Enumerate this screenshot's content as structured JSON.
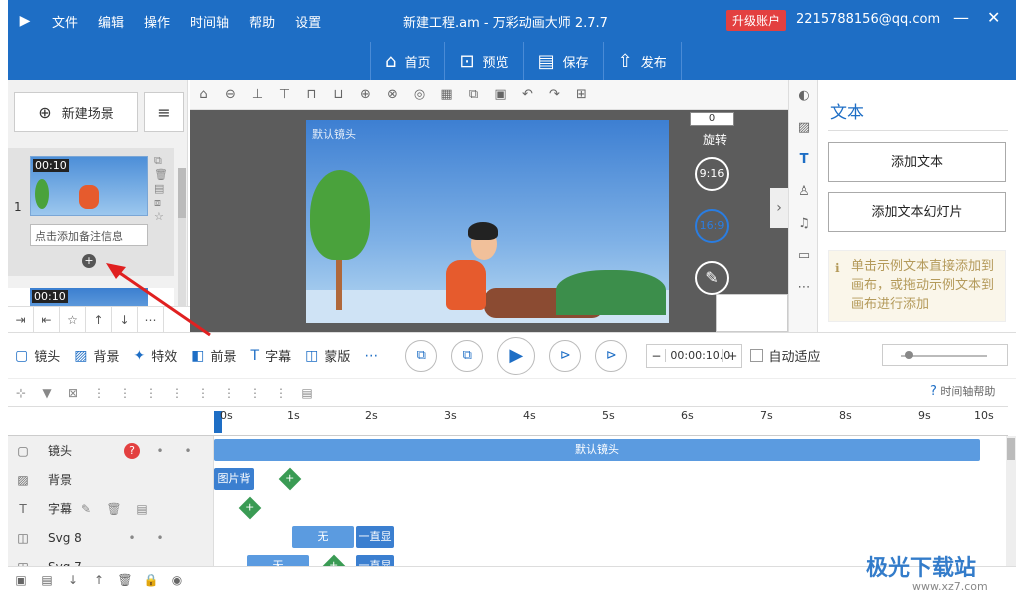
{
  "app": {
    "title": "新建工程.am - 万彩动画大师 2.7.7",
    "upgrade": "升级账户",
    "account": "2215788156@qq.com",
    "logo": "▶"
  },
  "menu": [
    "文件",
    "编辑",
    "操作",
    "时间轴",
    "帮助",
    "设置"
  ],
  "window_controls": [
    "—",
    "▢",
    "✕"
  ],
  "mainbar": [
    {
      "icon": "⌂",
      "label": "首页"
    },
    {
      "icon": "⊡",
      "label": "预览"
    },
    {
      "icon": "▤",
      "label": "保存"
    },
    {
      "icon": "⇧",
      "label": "发布"
    }
  ],
  "scenes": {
    "new_scene": "新建场景",
    "sort_icon": "≡",
    "items": [
      {
        "num": "1",
        "duration": "00:10",
        "note": "点击添加备注信息"
      },
      {
        "num": "",
        "duration": "00:10",
        "note": ""
      }
    ],
    "add_symbol": "+",
    "tools": [
      "⇥",
      "⇤",
      "☆",
      "↑",
      "↓",
      "⋯"
    ]
  },
  "canvas_tools": [
    "⌂",
    "⊖",
    "⊥",
    "⊤",
    "⊓",
    "⊔",
    "⊕",
    "⊗",
    "◎",
    "▦",
    "⧉",
    "▣",
    "↶",
    "↷",
    "⊞"
  ],
  "stage": {
    "camera_label": "默认镜头",
    "rotate_value": "0",
    "rotate_label": "旋转",
    "ratio_916": "9:16",
    "ratio_169": "16:9",
    "edit_icon": "✎",
    "expand": "›"
  },
  "right_strip": [
    {
      "icon": "◐",
      "active": false
    },
    {
      "icon": "▨",
      "active": false
    },
    {
      "icon": "T",
      "active": true
    },
    {
      "icon": "♙",
      "active": false
    },
    {
      "icon": "♫",
      "active": false
    },
    {
      "icon": "▭",
      "active": false
    },
    {
      "icon": "⋯",
      "active": false
    }
  ],
  "right_panel": {
    "title": "文本",
    "add_text": "添加文本",
    "add_text_slide": "添加文本幻灯片",
    "tip": "单击示例文本直接添加到画布，或拖动示例文本到画布进行添加",
    "tip_icon": "ℹ"
  },
  "controls": {
    "items": [
      {
        "icon": "▢",
        "label": "镜头"
      },
      {
        "icon": "▨",
        "label": "背景"
      },
      {
        "icon": "✦",
        "label": "特效"
      },
      {
        "icon": "◧",
        "label": "前景"
      },
      {
        "icon": "T",
        "label": "字幕"
      },
      {
        "icon": "◫",
        "label": "蒙版"
      },
      {
        "icon": "⋯",
        "label": ""
      }
    ],
    "play_buttons": [
      "⧉",
      "⧉",
      "▶",
      "⊳",
      "⊳"
    ],
    "time_minus": "−",
    "time_value": "00:00:10.0",
    "time_plus": "+",
    "autofit": "自动适应"
  },
  "timeline_tools": [
    "⊹",
    "▼",
    "⊠",
    "⋮",
    "⋮",
    "⋮",
    "⋮",
    "⋮",
    "⋮",
    "⋮",
    "⋮",
    "▤"
  ],
  "timeline_help": "时间轴帮助",
  "ruler": [
    "0s",
    "1s",
    "2s",
    "3s",
    "4s",
    "5s",
    "6s",
    "7s",
    "8s",
    "9s",
    "10s"
  ],
  "tracks": [
    {
      "icon": "▢",
      "name": "镜头",
      "badge": "?",
      "clips": [
        {
          "label": "默认镜头"
        }
      ]
    },
    {
      "icon": "▨",
      "name": "背景",
      "clips": [
        {
          "label": "图片背"
        }
      ],
      "plus": "+"
    },
    {
      "icon": "T",
      "name": "字幕",
      "actions": [
        "✎",
        "🗑",
        "▤"
      ],
      "plus": "+"
    },
    {
      "icon": "◫",
      "name": "Svg 8",
      "clips": [
        {
          "label": "无"
        },
        {
          "label": "一直显"
        }
      ]
    },
    {
      "icon": "◫",
      "name": "Svg 7",
      "clips": [
        {
          "label": "无"
        },
        {
          "label": "一直显"
        }
      ],
      "plus": "+"
    }
  ],
  "bottom_tools": [
    "▣",
    "▤",
    "↓",
    "↑",
    "🗑",
    "🔒",
    "◉"
  ],
  "watermark": {
    "text": "极光下载站",
    "url": "www.xz7.com"
  }
}
